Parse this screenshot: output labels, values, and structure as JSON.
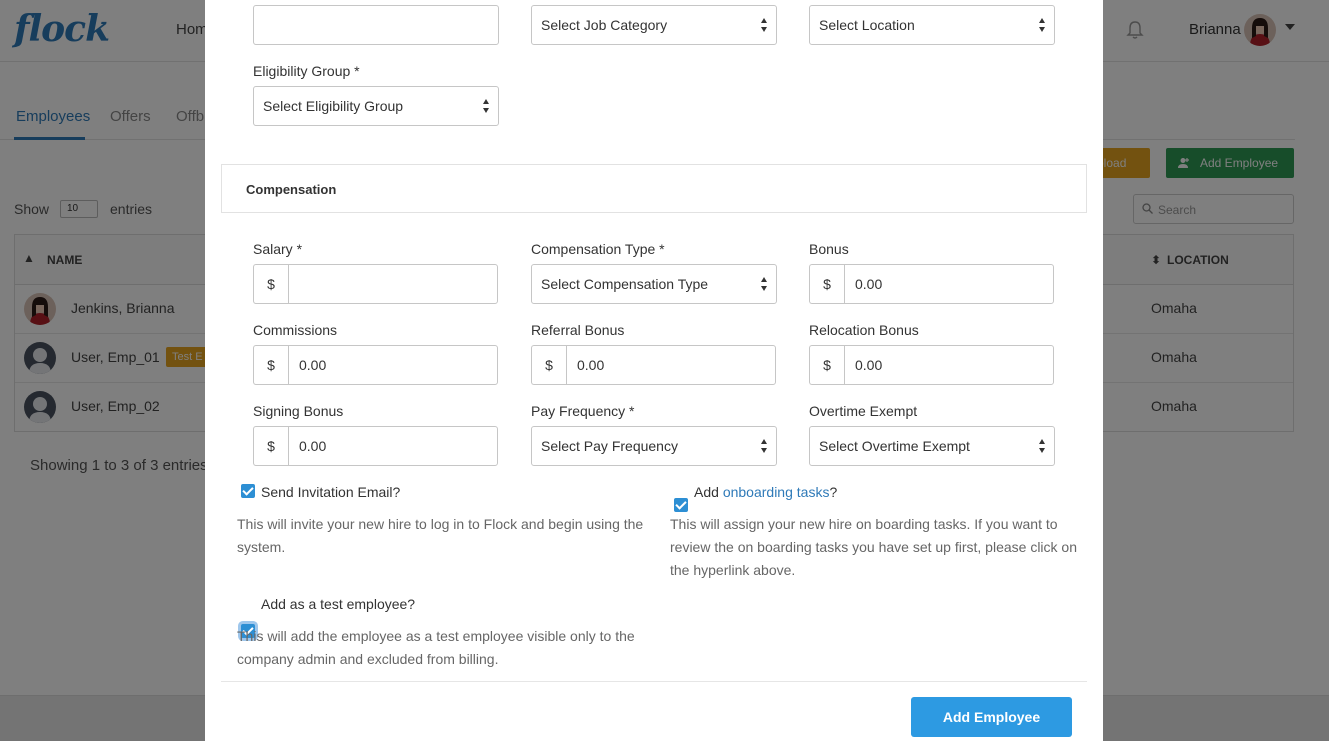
{
  "app": {
    "logo": "flock",
    "nav_home": "Hom",
    "user_name": "Brianna"
  },
  "tabs": [
    "Employees",
    "Offers",
    "Offb"
  ],
  "toolbar": {
    "upload_label": "pload",
    "add_employee_label": "Add Employee",
    "search_placeholder": "Search"
  },
  "table_controls": {
    "show_label": "Show",
    "show_value": "10",
    "entries_label": "entries"
  },
  "table": {
    "col_name": "NAME",
    "col_location": "LOCATION",
    "rows": [
      {
        "name": "Jenkins, Brianna",
        "badge": "",
        "location": "Omaha"
      },
      {
        "name": "User, Emp_01",
        "badge": "Test E",
        "location": "Omaha"
      },
      {
        "name": "User, Emp_02",
        "badge": "",
        "location": "Omaha"
      }
    ],
    "showing_text": "Showing 1 to 3 of 3 entries"
  },
  "modal": {
    "job_category_placeholder": "Select Job Category",
    "location_placeholder": "Select Location",
    "eligibility_label": "Eligibility Group *",
    "eligibility_placeholder": "Select Eligibility Group",
    "section_compensation": "Compensation",
    "currency": "$",
    "salary_label": "Salary *",
    "salary_value": "",
    "comp_type_label": "Compensation Type *",
    "comp_type_placeholder": "Select Compensation Type",
    "bonus_label": "Bonus",
    "bonus_value": "0.00",
    "commissions_label": "Commissions",
    "commissions_value": "0.00",
    "referral_label": "Referral Bonus",
    "referral_value": "0.00",
    "relocation_label": "Relocation Bonus",
    "relocation_value": "0.00",
    "signing_label": "Signing Bonus",
    "signing_value": "0.00",
    "pay_freq_label": "Pay Frequency *",
    "pay_freq_placeholder": "Select Pay Frequency",
    "overtime_label": "Overtime Exempt",
    "overtime_placeholder": "Select Overtime Exempt",
    "send_invite_label": "Send Invitation Email?",
    "send_invite_help": "This will invite your new hire to log in to Flock and begin using the system.",
    "onboarding_prefix": "Add ",
    "onboarding_link": "onboarding tasks",
    "onboarding_suffix": "?",
    "onboarding_help": "This will assign your new hire on boarding tasks. If you want to review the on boarding tasks you have set up first, please click on the hyperlink above.",
    "test_employee_label": "Add as a test employee?",
    "test_employee_help": "This will add the employee as a test employee visible only to the company admin and excluded from billing.",
    "submit_label": "Add Employee"
  },
  "colors": {
    "primary": "#2d9ae2",
    "brand": "#2f7ab8",
    "success": "#2e9a55",
    "warning": "#e6a520"
  }
}
